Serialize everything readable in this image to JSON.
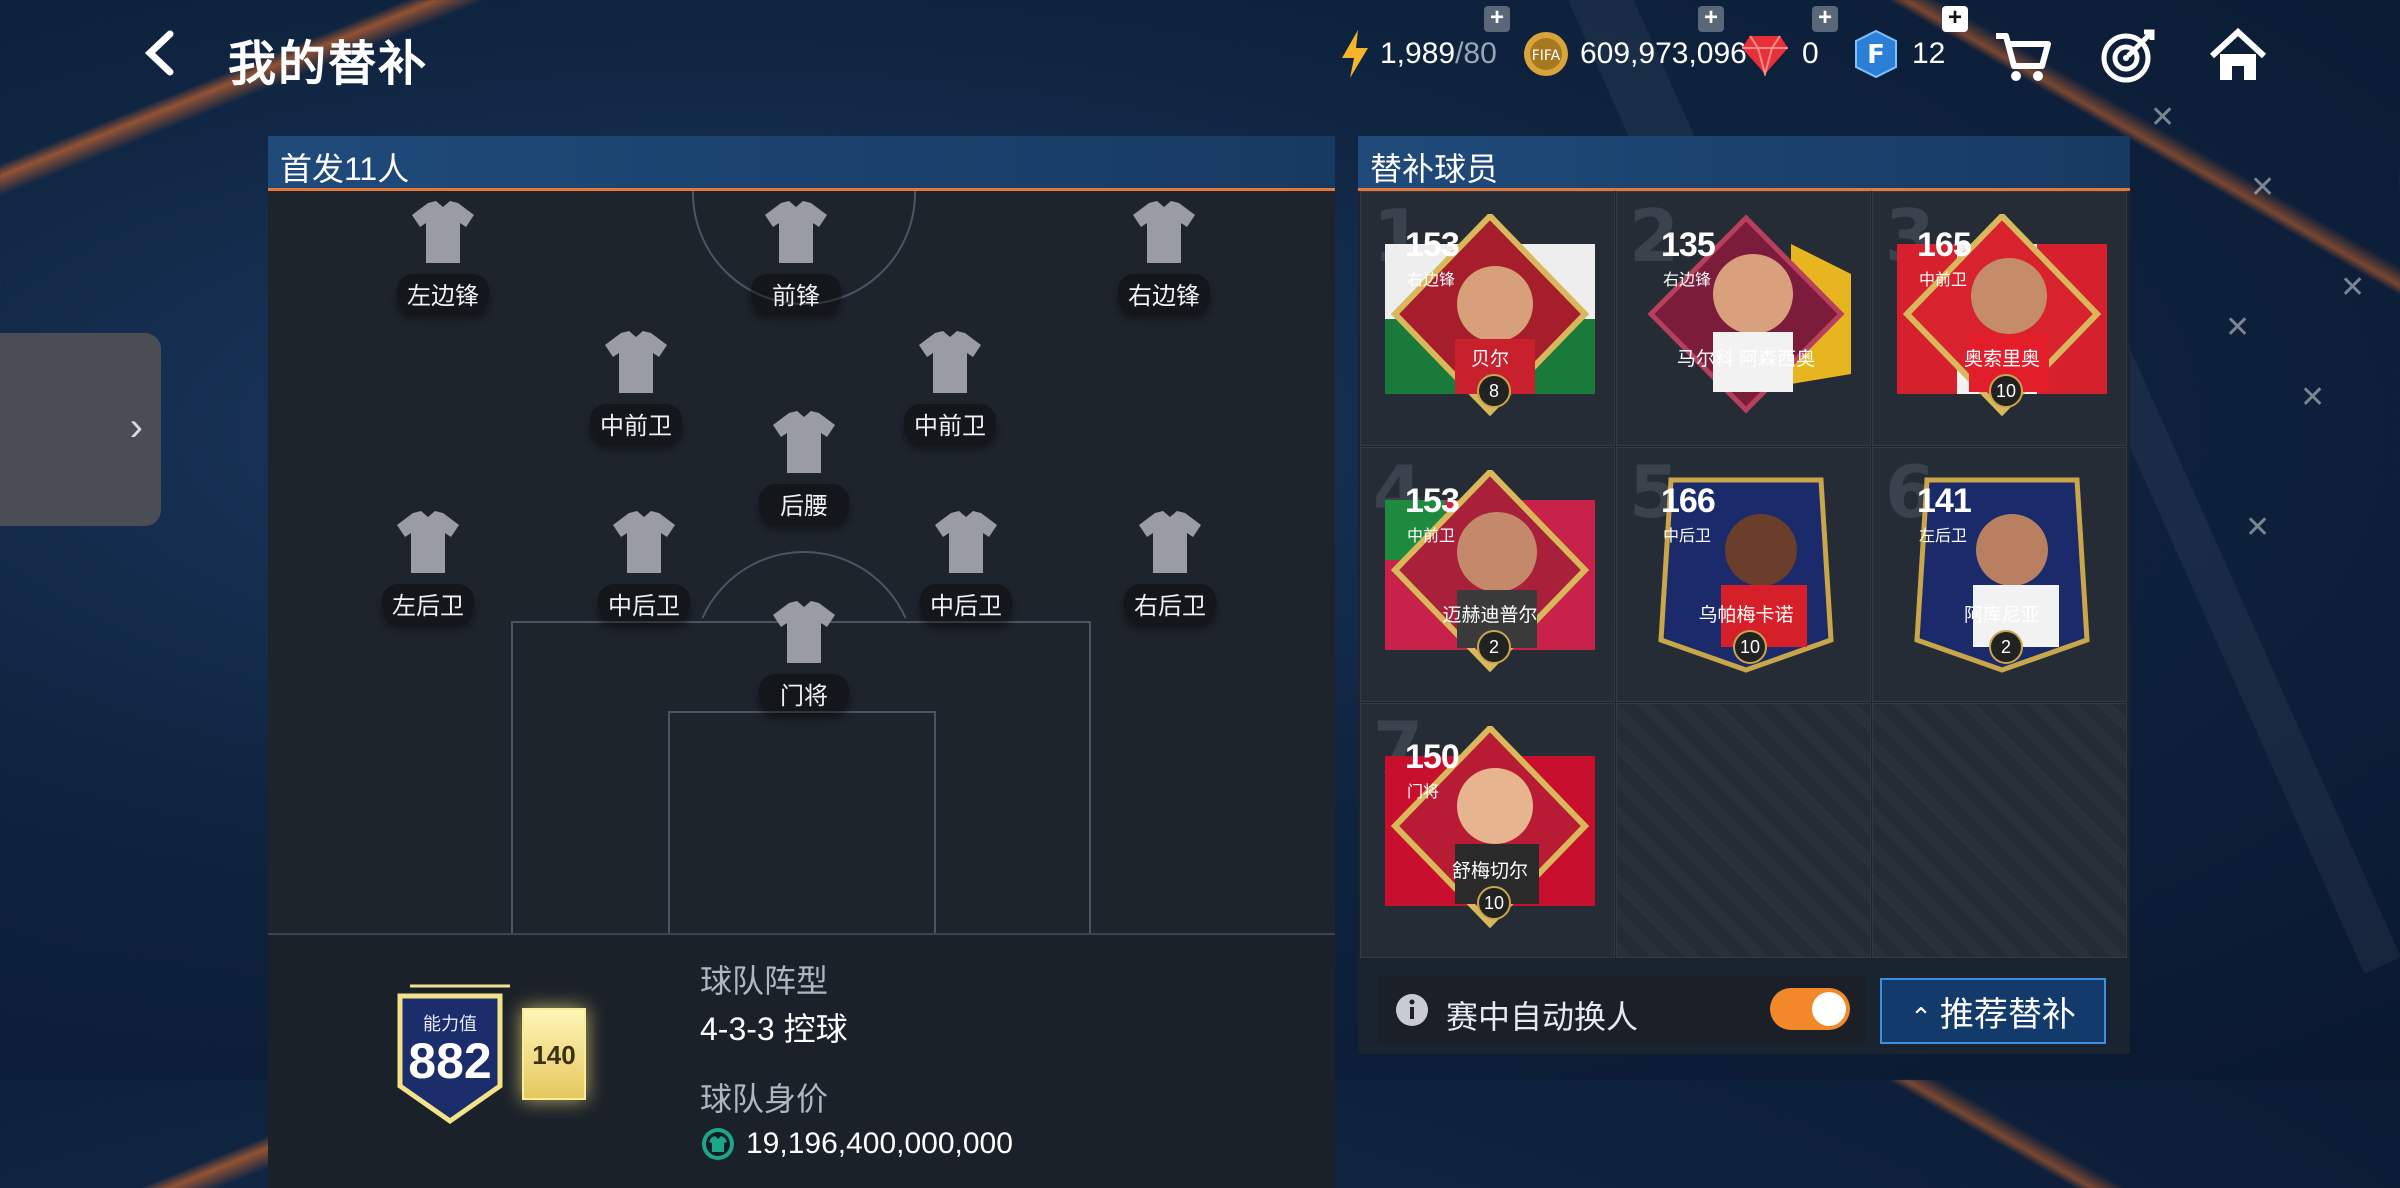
{
  "topbar": {
    "title": "我的替补",
    "energy": "1,989",
    "energy_max": "/80",
    "coins": "609,973,096",
    "gems": "0",
    "fifa_points": "12",
    "plus": "+"
  },
  "starters_panel": {
    "header": "首发11人",
    "positions": [
      "左边锋",
      "前锋",
      "右边锋",
      "中前卫",
      "后腰",
      "中前卫",
      "左后卫",
      "中后卫",
      "中后卫",
      "右后卫",
      "门将"
    ]
  },
  "team_info": {
    "ovr_label": "能力值",
    "ovr": "882",
    "ovr_sub": "140",
    "formation_label": "球队阵型",
    "formation": "4-3-3 控球",
    "value_label": "球队身价",
    "value": "19,196,400,000,000"
  },
  "subs_panel": {
    "header": "替补球员",
    "slots": [
      {
        "num": "1",
        "rating": "153",
        "pos": "右边锋",
        "name": "贝尔",
        "grade": "8",
        "accent": "#c9a64a"
      },
      {
        "num": "2",
        "rating": "135",
        "pos": "右边锋",
        "name": "马尔科 阿森西奥",
        "grade": "",
        "accent": "#9b2a48"
      },
      {
        "num": "3",
        "rating": "165",
        "pos": "中前卫",
        "name": "奥索里奥",
        "grade": "10",
        "accent": "#c9a64a"
      },
      {
        "num": "4",
        "rating": "153",
        "pos": "中前卫",
        "name": "迈赫迪普尔",
        "grade": "2",
        "accent": "#c9a64a"
      },
      {
        "num": "5",
        "rating": "166",
        "pos": "中后卫",
        "name": "乌帕梅卡诺",
        "grade": "10",
        "accent": "#2a4aa0"
      },
      {
        "num": "6",
        "rating": "141",
        "pos": "左后卫",
        "name": "阿库尼亚",
        "grade": "2",
        "accent": "#2a4aa0"
      },
      {
        "num": "7",
        "rating": "150",
        "pos": "门将",
        "name": "舒梅切尔",
        "grade": "10",
        "accent": "#c9a64a"
      }
    ],
    "auto_sub_label": "赛中自动换人",
    "recommend_label": "推荐替补"
  }
}
